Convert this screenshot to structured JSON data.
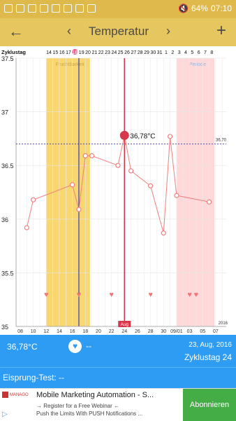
{
  "status_bar": {
    "battery": "64%",
    "time": "07:10",
    "icons": [
      "image-icon",
      "mail-icon",
      "office-icon",
      "mail-icon",
      "wifi-icon",
      "maps-icon",
      "calendar-icon",
      "more-icon"
    ]
  },
  "app_bar": {
    "title": "Temperatur",
    "back_icon": "arrow-back-icon",
    "add_icon": "add-icon",
    "prev_icon": "chevron-left-icon",
    "next_icon": "chevron-right-icon"
  },
  "chart_data": {
    "type": "line",
    "y_ticks": [
      "37.5",
      "37",
      "36.5",
      "36",
      "35.5",
      "35"
    ],
    "ylim": [
      35,
      37.5
    ],
    "cycle_label": "Zyklustag",
    "cycle_days": [
      "14",
      "15",
      "16",
      "17",
      "18",
      "19",
      "20",
      "21",
      "22",
      "23",
      "24",
      "25",
      "26",
      "27",
      "28",
      "29",
      "30",
      "31",
      "1",
      "2",
      "3",
      "4",
      "5",
      "6",
      "7",
      "8"
    ],
    "cycle_start_index": 0,
    "x_tick_labels": [
      {
        "day": 0,
        "label": "08"
      },
      {
        "day": 2,
        "label": "10"
      },
      {
        "day": 4,
        "label": "12"
      },
      {
        "day": 6,
        "label": "14"
      },
      {
        "day": 8,
        "label": "16"
      },
      {
        "day": 10,
        "label": "18"
      },
      {
        "day": 12,
        "label": "20"
      },
      {
        "day": 14,
        "label": "22"
      },
      {
        "day": 16,
        "label": "24"
      },
      {
        "day": 18,
        "label": "26"
      },
      {
        "day": 20,
        "label": "28"
      },
      {
        "day": 22,
        "label": "30"
      },
      {
        "day": 24,
        "label": "09/01"
      },
      {
        "day": 26,
        "label": "03"
      },
      {
        "day": 28,
        "label": "05"
      },
      {
        "day": 30,
        "label": "07"
      }
    ],
    "year_label": "2016",
    "month_marker": "Aug",
    "cover_line": {
      "value": 36.7,
      "label": "36,70"
    },
    "fertile_window": {
      "label": "Fruchtbarkeit",
      "start_day": 4.0,
      "end_day": 10.7,
      "color": "#f8d670"
    },
    "period_window": {
      "label": "Periode",
      "start_day": 24.0,
      "end_day": 29.8,
      "color": "#ffd9d9"
    },
    "ovulation_day": 9,
    "selected": {
      "day": 16,
      "value": 36.78,
      "label": "36,78°C"
    },
    "series": [
      {
        "x": [
          1,
          2,
          8,
          9,
          10,
          11,
          15,
          16,
          17,
          20,
          22,
          23,
          24,
          29
        ],
        "values": [
          35.92,
          36.18,
          36.32,
          36.09,
          36.59,
          36.59,
          36.5,
          36.78,
          36.45,
          36.31,
          35.87,
          36.77,
          36.22,
          36.16
        ],
        "color": "#f08080"
      }
    ],
    "heart_days": [
      4,
      9,
      14,
      20,
      26,
      27
    ],
    "grid": true
  },
  "info": {
    "temperature": "36,78°C",
    "heart_icon": "heart-icon",
    "value": "--",
    "date": "23, Aug, 2016",
    "cycle_day": "Zyklustag 24"
  },
  "ovulation_test": {
    "label": "Eisprung-Test: --"
  },
  "ad": {
    "logo": "MANAGO",
    "title": "Mobile Marketing Automation - S...",
    "line1": "→ Register for a Free Webinar ←",
    "line2": "Push the Limits With PUSH Notifications ...",
    "button": "Abonnieren"
  }
}
